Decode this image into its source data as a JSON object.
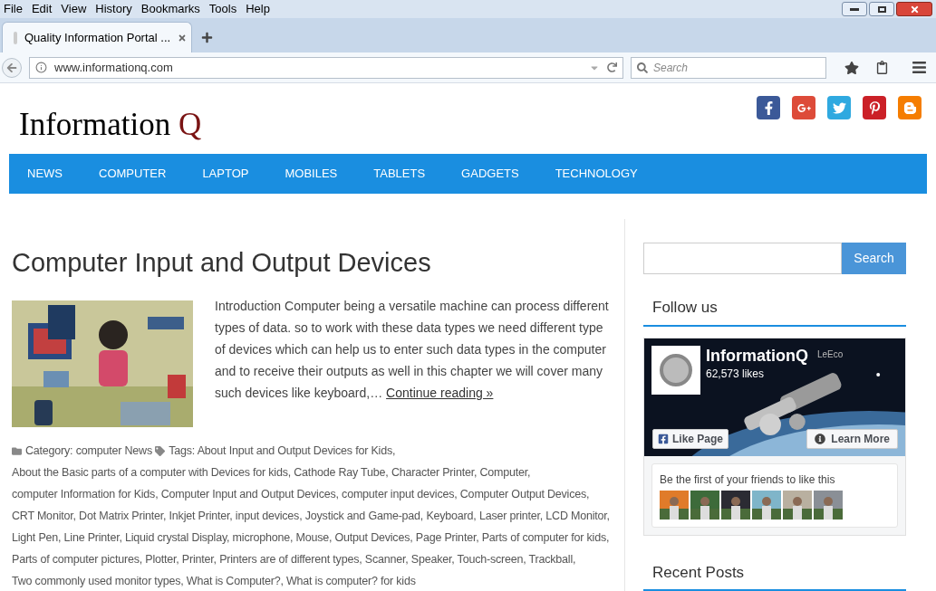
{
  "menu_bar": [
    "File",
    "Edit",
    "View",
    "History",
    "Bookmarks",
    "Tools",
    "Help"
  ],
  "tabs": [
    {
      "label": "Quality Information Portal ...",
      "selected": true
    }
  ],
  "address_bar": {
    "url": "www.informationq.com"
  },
  "search_box": {
    "placeholder": "Search"
  },
  "site": {
    "logo": {
      "text": "Information",
      "accent": "Q"
    },
    "social": [
      {
        "kind": "facebook",
        "color": "#3b5998"
      },
      {
        "kind": "googleplus",
        "color": "#dd4b39"
      },
      {
        "kind": "twitter",
        "color": "#2fa9e0"
      },
      {
        "kind": "pinterest",
        "color": "#cb2027"
      },
      {
        "kind": "blogger",
        "color": "#f57d00"
      }
    ],
    "nav": [
      "NEWS",
      "COMPUTER",
      "LAPTOP",
      "MOBILES",
      "TABLETS",
      "GADGETS",
      "TECHNOLOGY"
    ]
  },
  "article": {
    "title": "Computer Input and Output Devices",
    "excerpt": "Introduction Computer being a versatile machine can process different types of data. so to work with these data types we need different type of devices which can help us to enter such data types in the computer and to receive their outputs as well in this chapter we will cover many such devices like keyboard,…",
    "continue_link": "Continue reading »",
    "category_label": "Category:",
    "categories": [
      "computer",
      "News"
    ],
    "tags_label": "Tags:",
    "tags": [
      "About Input and Output Devices for Kids,",
      "About the Basic parts of a computer with Devices for kids,",
      "Cathode Ray Tube,",
      "Character Printer,",
      "Computer,",
      "computer Information for Kids,",
      "Computer Input and Output Devices,",
      "computer input devices,",
      "Computer Output Devices,",
      "CRT Monitor,",
      "Dot Matrix Printer,",
      "Inkjet Printer,",
      "input devices,",
      "Joystick and Game-pad,",
      "Keyboard,",
      "Laser printer,",
      "LCD Monitor,",
      "Light Pen,",
      "Line Printer,",
      "Liquid crystal Display,",
      "microphone,",
      "Mouse,",
      "Output Devices,",
      "Page Printer,",
      "Parts of computer for kids,",
      "Parts of computer pictures,",
      "Plotter,",
      "Printer,",
      "Printers are of different types,",
      "Scanner,",
      "Speaker,",
      "Touch-screen,",
      "Trackball,",
      "Two commonly used monitor types,",
      "What is Computer?,",
      "What is computer? for kids"
    ]
  },
  "sidebar": {
    "search_button": "Search",
    "follow_heading": "Follow us",
    "facebook_widget": {
      "page_name": "InformationQ",
      "likes": "62,573 likes",
      "cover_brand": "LeEco",
      "like_button": "Like Page",
      "learn_button": "Learn More",
      "friends_text": "Be the first of your friends to like this"
    },
    "recent_heading": "Recent Posts"
  }
}
